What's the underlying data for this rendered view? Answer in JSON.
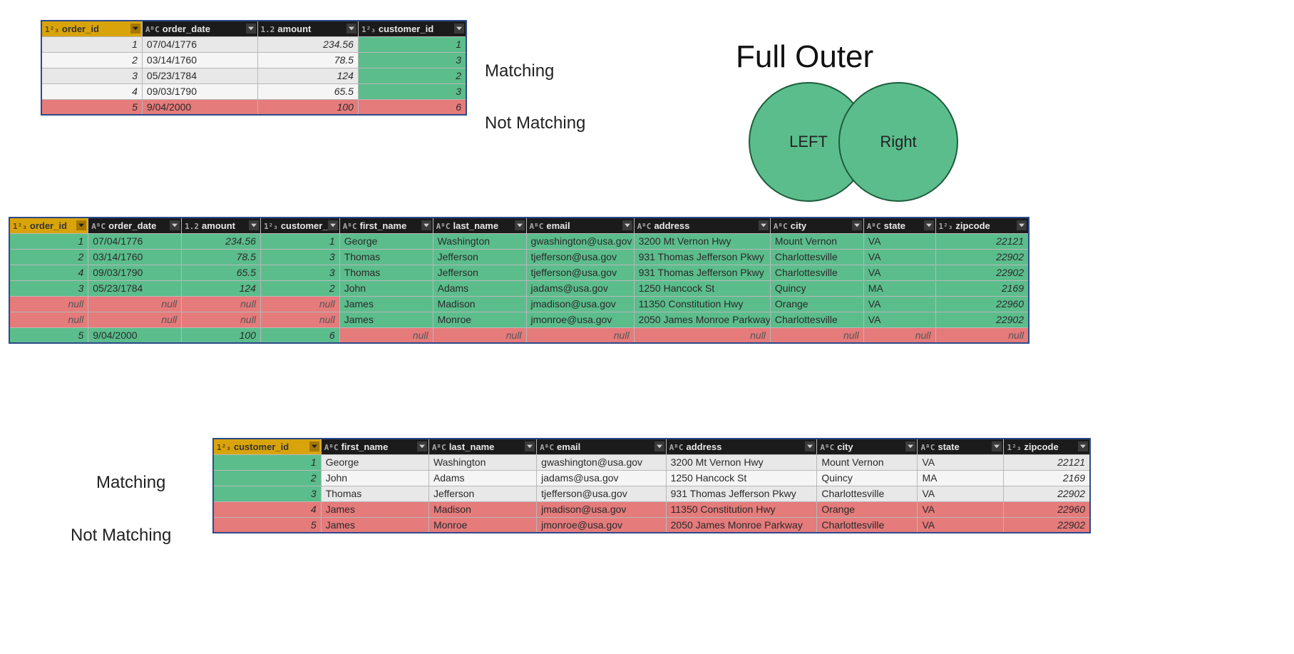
{
  "title": "Full Outer",
  "venn": {
    "left": "LEFT",
    "right": "Right"
  },
  "labels": {
    "matching_top": "Matching",
    "notmatching_top": "Not Matching",
    "matching_bottom": "Matching",
    "notmatching_bottom": "Not Matching"
  },
  "type_icons": {
    "int123": "1²₃",
    "text_abc": "AᴮC",
    "decimal": "1.2"
  },
  "orders": {
    "columns": [
      "order_id",
      "order_date",
      "amount",
      "customer_id"
    ],
    "col_types": [
      "int123",
      "text_abc",
      "decimal",
      "int123"
    ],
    "rows": [
      {
        "order_id": 1,
        "order_date": "07/04/1776",
        "amount": "234.56",
        "customer_id": 1,
        "match": true
      },
      {
        "order_id": 2,
        "order_date": "03/14/1760",
        "amount": "78.5",
        "customer_id": 3,
        "match": true
      },
      {
        "order_id": 3,
        "order_date": "05/23/1784",
        "amount": "124",
        "customer_id": 2,
        "match": true
      },
      {
        "order_id": 4,
        "order_date": "09/03/1790",
        "amount": "65.5",
        "customer_id": 3,
        "match": true
      },
      {
        "order_id": 5,
        "order_date": "9/04/2000",
        "amount": "100",
        "customer_id": 6,
        "match": false
      }
    ]
  },
  "joined": {
    "columns": [
      "order_id",
      "order_date",
      "amount",
      "customer_id",
      "first_name",
      "last_name",
      "email",
      "address",
      "city",
      "state",
      "zipcode"
    ],
    "col_types": [
      "int123",
      "text_abc",
      "decimal",
      "int123",
      "text_abc",
      "text_abc",
      "text_abc",
      "text_abc",
      "text_abc",
      "text_abc",
      "int123"
    ],
    "null": "null",
    "rows": [
      {
        "left_style": "green",
        "right_style": "green",
        "order_id": 1,
        "order_date": "07/04/1776",
        "amount": "234.56",
        "customer_id": 1,
        "first_name": "George",
        "last_name": "Washington",
        "email": "gwashington@usa.gov",
        "address": "3200 Mt Vernon Hwy",
        "city": "Mount Vernon",
        "state": "VA",
        "zipcode": 22121
      },
      {
        "left_style": "green",
        "right_style": "green",
        "order_id": 2,
        "order_date": "03/14/1760",
        "amount": "78.5",
        "customer_id": 3,
        "first_name": "Thomas",
        "last_name": "Jefferson",
        "email": "tjefferson@usa.gov",
        "address": "931 Thomas Jefferson Pkwy",
        "city": "Charlottesville",
        "state": "VA",
        "zipcode": 22902
      },
      {
        "left_style": "green",
        "right_style": "green",
        "order_id": 4,
        "order_date": "09/03/1790",
        "amount": "65.5",
        "customer_id": 3,
        "first_name": "Thomas",
        "last_name": "Jefferson",
        "email": "tjefferson@usa.gov",
        "address": "931 Thomas Jefferson Pkwy",
        "city": "Charlottesville",
        "state": "VA",
        "zipcode": 22902
      },
      {
        "left_style": "green",
        "right_style": "green",
        "order_id": 3,
        "order_date": "05/23/1784",
        "amount": "124",
        "customer_id": 2,
        "first_name": "John",
        "last_name": "Adams",
        "email": "jadams@usa.gov",
        "address": "1250 Hancock St",
        "city": "Quincy",
        "state": "MA",
        "zipcode": 2169
      },
      {
        "left_style": "red",
        "right_style": "green",
        "order_id": null,
        "order_date": null,
        "amount": null,
        "customer_id": null,
        "first_name": "James",
        "last_name": "Madison",
        "email": "jmadison@usa.gov",
        "address": "11350 Constitution Hwy",
        "city": "Orange",
        "state": "VA",
        "zipcode": 22960
      },
      {
        "left_style": "red",
        "right_style": "green",
        "order_id": null,
        "order_date": null,
        "amount": null,
        "customer_id": null,
        "first_name": "James",
        "last_name": "Monroe",
        "email": "jmonroe@usa.gov",
        "address": "2050 James Monroe Parkway",
        "city": "Charlottesville",
        "state": "VA",
        "zipcode": 22902
      },
      {
        "left_style": "green",
        "right_style": "red",
        "order_id": 5,
        "order_date": "9/04/2000",
        "amount": "100",
        "customer_id": 6,
        "first_name": null,
        "last_name": null,
        "email": null,
        "address": null,
        "city": null,
        "state": null,
        "zipcode": null
      }
    ]
  },
  "customers": {
    "columns": [
      "customer_id",
      "first_name",
      "last_name",
      "email",
      "address",
      "city",
      "state",
      "zipcode"
    ],
    "col_types": [
      "int123",
      "text_abc",
      "text_abc",
      "text_abc",
      "text_abc",
      "text_abc",
      "text_abc",
      "int123"
    ],
    "rows": [
      {
        "customer_id": 1,
        "first_name": "George",
        "last_name": "Washington",
        "email": "gwashington@usa.gov",
        "address": "3200 Mt Vernon Hwy",
        "city": "Mount Vernon",
        "state": "VA",
        "zipcode": 22121,
        "match": true
      },
      {
        "customer_id": 2,
        "first_name": "John",
        "last_name": "Adams",
        "email": "jadams@usa.gov",
        "address": "1250 Hancock St",
        "city": "Quincy",
        "state": "MA",
        "zipcode": 2169,
        "match": true
      },
      {
        "customer_id": 3,
        "first_name": "Thomas",
        "last_name": "Jefferson",
        "email": "tjefferson@usa.gov",
        "address": "931 Thomas Jefferson Pkwy",
        "city": "Charlottesville",
        "state": "VA",
        "zipcode": 22902,
        "match": true
      },
      {
        "customer_id": 4,
        "first_name": "James",
        "last_name": "Madison",
        "email": "jmadison@usa.gov",
        "address": "11350 Constitution Hwy",
        "city": "Orange",
        "state": "VA",
        "zipcode": 22960,
        "match": false
      },
      {
        "customer_id": 5,
        "first_name": "James",
        "last_name": "Monroe",
        "email": "jmonroe@usa.gov",
        "address": "2050 James Monroe Parkway",
        "city": "Charlottesville",
        "state": "VA",
        "zipcode": 22902,
        "match": false
      }
    ]
  }
}
